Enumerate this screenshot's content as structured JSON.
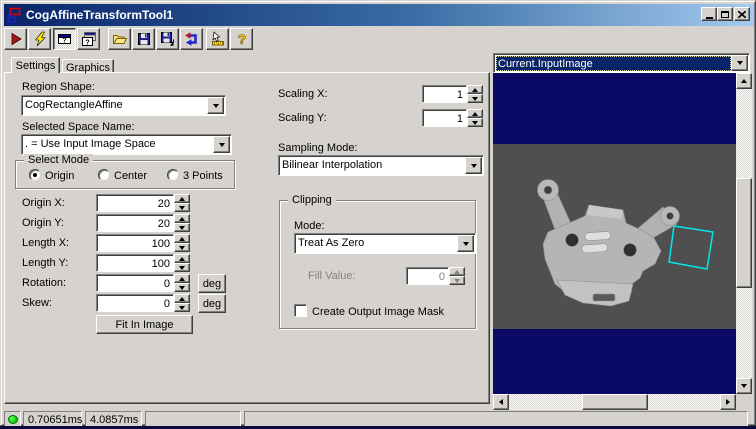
{
  "window": {
    "title": "CogAffineTransformTool1",
    "icon": "transform-tool-icon",
    "controls": [
      "minimize",
      "maximize",
      "close"
    ]
  },
  "toolbar": {
    "icons": [
      "run-icon",
      "lightning-icon",
      "float-tool-window-icon",
      "cascade-tool-windows-icon",
      "open-folder-icon",
      "save-icon",
      "save-as-icon",
      "reset-icon",
      "electrode-icon",
      "help-icon"
    ]
  },
  "tabs": [
    {
      "label": "Settings",
      "active": true
    },
    {
      "label": "Graphics",
      "active": false
    }
  ],
  "settings": {
    "region_shape_label": "Region Shape:",
    "region_shape_value": "CogRectangleAffine",
    "space_name_label": "Selected Space Name:",
    "space_name_value": ". = Use Input Image Space",
    "select_mode": {
      "title": "Select Mode",
      "options": [
        {
          "label": "Origin",
          "selected": true
        },
        {
          "label": "Center",
          "selected": false
        },
        {
          "label": "3 Points",
          "selected": false
        }
      ]
    },
    "fields": [
      {
        "label": "Origin X:",
        "value": "20"
      },
      {
        "label": "Origin Y:",
        "value": "20"
      },
      {
        "label": "Length X:",
        "value": "100"
      },
      {
        "label": "Length Y:",
        "value": "100"
      },
      {
        "label": "Rotation:",
        "value": "0",
        "unit": "deg"
      },
      {
        "label": "Skew:",
        "value": "0",
        "unit": "deg"
      }
    ],
    "fit_button_label": "Fit In Image",
    "scaling_x_label": "Scaling X:",
    "scaling_x_value": "1",
    "scaling_y_label": "Scaling Y:",
    "scaling_y_value": "1",
    "sampling_mode_label": "Sampling Mode:",
    "sampling_mode_value": "Bilinear Interpolation",
    "clipping": {
      "title": "Clipping",
      "mode_label": "Mode:",
      "mode_value": "Treat As Zero",
      "fill_value_label": "Fill Value:",
      "fill_value": "0",
      "fill_value_enabled": false,
      "mask_label": "Create Output Image Mask",
      "mask_checked": false
    }
  },
  "image_panel": {
    "selector_value": "Current.InputImage",
    "background_color": "#0a0a66",
    "photo_background": "#4f4f4f",
    "overlay_color": "#00e8e8"
  },
  "status_bar": {
    "led_color": "#00d800",
    "timings": [
      "0.70651ms",
      "4.0857ms"
    ]
  }
}
